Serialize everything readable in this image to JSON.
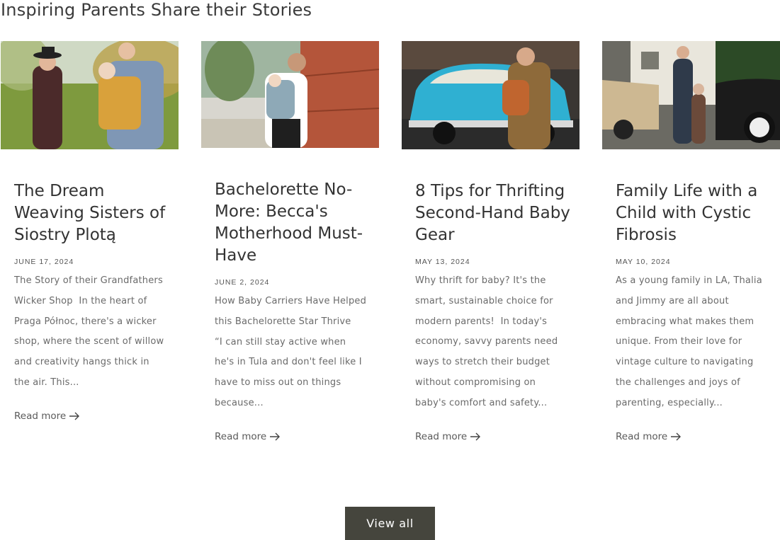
{
  "section": {
    "title": "Inspiring Parents Share their Stories"
  },
  "cards": [
    {
      "title": "The Dream Weaving Sisters of Siostry Plotą",
      "date": "JUNE 17, 2024",
      "excerpt": "The Story of their Grandfathers Wicker Shop  In the heart of Praga Północ, there's a wicker shop, where the scent of willow and creativity hangs thick in the air. This...",
      "read_more": "Read more"
    },
    {
      "title": "Bachelorette No-More: Becca's Motherhood Must-Have",
      "date": "JUNE 2, 2024",
      "excerpt": "How Baby Carriers Have Helped this Bachelorette Star Thrive      “I can still stay active when he's in Tula and don't feel like I have to miss out on things because...",
      "read_more": "Read more"
    },
    {
      "title": "8 Tips for Thrifting Second-Hand Baby Gear",
      "date": "MAY 13, 2024",
      "excerpt": "Why thrift for baby? It's the smart, sustainable choice for modern parents!  In today's economy, savvy parents need ways to stretch their budget without compromising on baby's comfort and safety...",
      "read_more": "Read more"
    },
    {
      "title": "Family Life with a Child with Cystic Fibrosis",
      "date": "MAY 10, 2024",
      "excerpt": "As a young family in LA, Thalia and Jimmy are all about embracing what makes them unique. From their love for vintage culture to navigating the challenges and joys of parenting, especially...",
      "read_more": "Read more"
    }
  ],
  "view_all": "View all"
}
